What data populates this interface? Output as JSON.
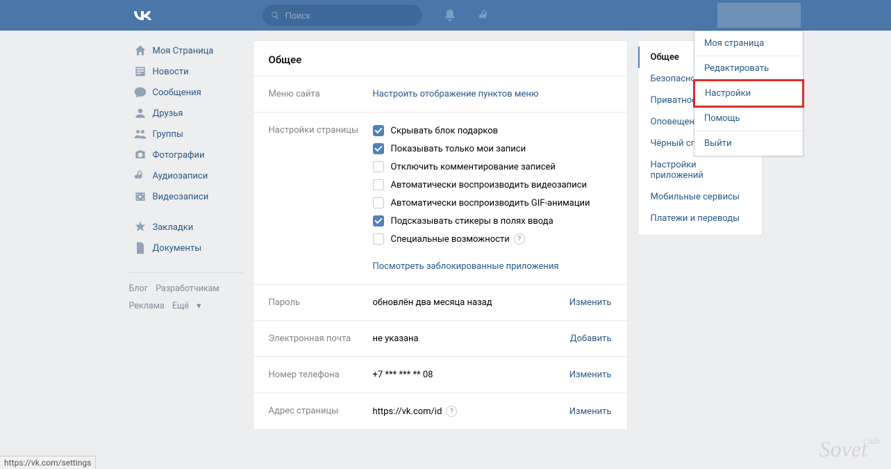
{
  "header": {
    "logo": "VK",
    "search_placeholder": "Поиск"
  },
  "sidebar": {
    "items": [
      {
        "label": "Моя Страница",
        "icon": "home-icon"
      },
      {
        "label": "Новости",
        "icon": "news-icon"
      },
      {
        "label": "Сообщения",
        "icon": "messages-icon"
      },
      {
        "label": "Друзья",
        "icon": "friends-icon"
      },
      {
        "label": "Группы",
        "icon": "groups-icon"
      },
      {
        "label": "Фотографии",
        "icon": "photos-icon"
      },
      {
        "label": "Аудиозаписи",
        "icon": "audio-icon"
      },
      {
        "label": "Видеозаписи",
        "icon": "video-icon"
      }
    ],
    "items2": [
      {
        "label": "Закладки",
        "icon": "bookmarks-icon"
      },
      {
        "label": "Документы",
        "icon": "docs-icon"
      }
    ],
    "footer": {
      "blog": "Блог",
      "devs": "Разработчикам",
      "ads": "Реклама",
      "more": "Ещё"
    }
  },
  "content": {
    "title": "Общее",
    "menu_section": {
      "label": "Меню сайта",
      "link": "Настроить отображение пунктов меню"
    },
    "page_settings": {
      "label": "Настройки страницы",
      "opts": [
        {
          "text": "Скрывать блок подарков",
          "checked": true
        },
        {
          "text": "Показывать только мои записи",
          "checked": true
        },
        {
          "text": "Отключить комментирование записей",
          "checked": false
        },
        {
          "text": "Автоматически воспроизводить видеозаписи",
          "checked": false
        },
        {
          "text": "Автоматически воспроизводить GIF-анимации",
          "checked": false
        },
        {
          "text": "Подсказывать стикеры в полях ввода",
          "checked": true
        },
        {
          "text": "Специальные возможности",
          "checked": false,
          "help": true
        }
      ],
      "blocked_link": "Посмотреть заблокированные приложения"
    },
    "password": {
      "label": "Пароль",
      "value": "обновлён два месяца назад",
      "action": "Изменить"
    },
    "email": {
      "label": "Электронная почта",
      "value": "не указана",
      "action": "Добавить"
    },
    "phone": {
      "label": "Номер телефона",
      "value": "+7 *** *** ** 08",
      "action": "Изменить"
    },
    "address": {
      "label": "Адрес страницы",
      "value": "https://vk.com/id",
      "action": "Изменить"
    }
  },
  "right_col": {
    "items": [
      {
        "label": "Общее",
        "active": true
      },
      {
        "label": "Безопасность"
      },
      {
        "label": "Приватность"
      },
      {
        "label": "Оповещения"
      },
      {
        "label": "Чёрный список"
      },
      {
        "label": "Настройки приложений"
      },
      {
        "label": "Мобильные сервисы"
      },
      {
        "label": "Платежи и переводы"
      }
    ]
  },
  "dropdown": {
    "items": [
      {
        "label": "Моя страница"
      },
      {
        "label": "Редактировать",
        "sep": true
      },
      {
        "label": "Настройки",
        "highlight": true
      },
      {
        "label": "Помощь"
      },
      {
        "label": "Выйти",
        "sep": true
      }
    ]
  },
  "status_url": "https://vk.com/settings",
  "watermark": {
    "main": "Sovet",
    "sub": "club"
  }
}
